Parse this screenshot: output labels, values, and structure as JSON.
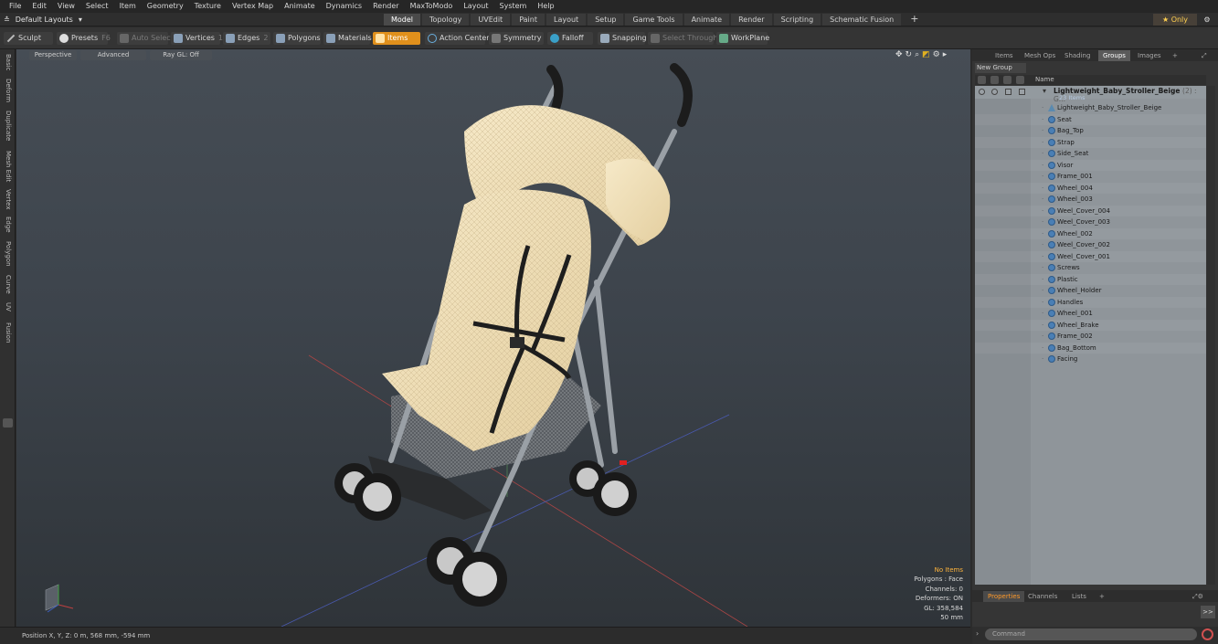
{
  "menubar": {
    "items": [
      "File",
      "Edit",
      "View",
      "Select",
      "Item",
      "Geometry",
      "Texture",
      "Vertex Map",
      "Animate",
      "Dynamics",
      "Render",
      "MaxToModo",
      "Layout",
      "System",
      "Help"
    ]
  },
  "layoutbar": {
    "layout_selector": "Default Layouts",
    "tabs": [
      "Model",
      "Topology",
      "UVEdit",
      "Paint",
      "Layout",
      "Setup",
      "Game Tools",
      "Animate",
      "Render",
      "Scripting",
      "Schematic Fusion"
    ],
    "active_tab": "Model",
    "add": "+",
    "only_label": "Only"
  },
  "toolbar": {
    "sculpt": "Sculpt",
    "presets": "Presets",
    "presets_key": "F6",
    "auto_select": "Auto Select",
    "vertices": "Vertices",
    "vertices_key": "1",
    "edges": "Edges",
    "edges_key": "2",
    "polygons": "Polygons",
    "polygons_key": "3",
    "materials": "Materials",
    "items": "Items",
    "action_center": "Action Center",
    "symmetry": "Symmetry",
    "falloff": "Falloff",
    "snapping": "Snapping",
    "select_through": "Select Through",
    "workplane": "WorkPlane"
  },
  "left_tabs": [
    "Basic",
    "Deform",
    "Duplicate",
    "Mesh Edit",
    "Vertex",
    "Edge",
    "Polygon",
    "Curve",
    "UV",
    "Fusion"
  ],
  "viewport": {
    "view_mode": "Perspective",
    "shading": "Advanced",
    "raygl": "Ray GL: Off",
    "info": {
      "selection": "No Items",
      "polygons": "Polygons : Face",
      "channels": "Channels: 0",
      "deformers": "Deformers: ON",
      "gl": "GL: 358,584",
      "distance": "50 mm"
    }
  },
  "statusbar": {
    "position": "Position X, Y, Z:  0 m, 568 mm, -594 mm"
  },
  "right_panel": {
    "tabs": [
      "Items",
      "Mesh Ops",
      "Shading",
      "Groups",
      "Images"
    ],
    "active_tab": "Groups",
    "new_group": "New Group",
    "column_name": "Name",
    "group": {
      "name": "Lightweight_Baby_Stroller_Beige",
      "count": "(2) : G...",
      "subtitle": "23 Items"
    },
    "items": [
      "Lightweight_Baby_Stroller_Beige",
      "Seat",
      "Bag_Top",
      "Strap",
      "Side_Seat",
      "Visor",
      "Frame_001",
      "Wheel_004",
      "Wheel_003",
      "Weel_Cover_004",
      "Weel_Cover_003",
      "Wheel_002",
      "Weel_Cover_002",
      "Weel_Cover_001",
      "Screws",
      "Plastic",
      "Wheel_Holder",
      "Handles",
      "Wheel_001",
      "Wheel_Brake",
      "Frame_002",
      "Bag_Bottom",
      "Facing"
    ],
    "prop_tabs": [
      "Properties",
      "Channels",
      "Lists"
    ],
    "prop_active": "Properties",
    "expand": ">>",
    "command_placeholder": "Command"
  },
  "colors": {
    "accent_orange": "#e0901c",
    "panel_bg": "#353535",
    "list_bg": "#8f959a",
    "viewport_top": "#464d55",
    "fabric": "#f0dfb8"
  }
}
